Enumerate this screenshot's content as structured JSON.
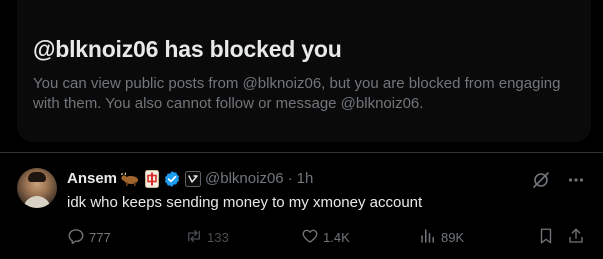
{
  "blocked": {
    "title": "@blknoiz06 has blocked you",
    "description": "You can view public posts from @blknoiz06, but you are blocked from engaging with them. You also cannot follow or message @blknoiz06."
  },
  "tweet": {
    "author_name": "Ansem",
    "handle": "@blknoiz06",
    "separator": "·",
    "time": "1h",
    "text": "idk who keeps sending money to my xmoney account",
    "replies": "777",
    "reposts": "133",
    "likes": "1.4K",
    "views": "89K"
  },
  "icons": {
    "emoji_1": "bull-emoji",
    "emoji_2": "mahjong-tile-emoji",
    "verified": "verified-badge-icon",
    "affiliate": "affiliate-badge-icon",
    "grok": "grok-icon",
    "more": "more-icon",
    "reply": "reply-icon",
    "repost": "repost-icon",
    "like": "heart-icon",
    "views": "views-icon",
    "bookmark": "bookmark-icon",
    "share": "share-icon"
  },
  "colors": {
    "background": "#000000",
    "card_background": "#0a0a0a",
    "primary_text": "#e7e9ea",
    "secondary_text": "#71767b",
    "verified_blue": "#1d9bf0",
    "divider": "#2f3336"
  }
}
